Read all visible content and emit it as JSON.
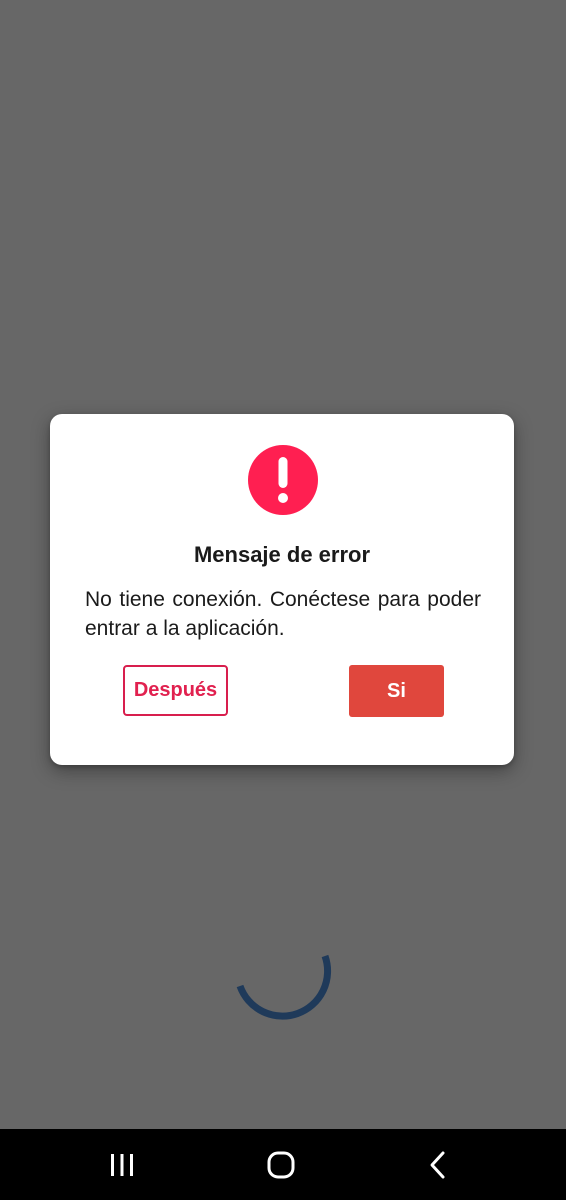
{
  "dialog": {
    "icon": "alert-circle-icon",
    "title": "Mensaje de error",
    "message": "No tiene conexión. Conéctese para poder entrar a la aplicación.",
    "later_label": "Después",
    "yes_label": "Si"
  },
  "colors": {
    "background_overlay": "#676767",
    "dialog_bg": "#ffffff",
    "alert_red": "#ff1f51",
    "later_border": "#d81e4d",
    "yes_bg": "#e0473d",
    "spinner": "#1f3a5a",
    "navbar_bg": "#000000"
  },
  "loading": {
    "icon": "loading-spinner"
  },
  "navbar": {
    "recent_icon": "recent-apps-icon",
    "home_icon": "home-icon",
    "back_icon": "back-icon"
  }
}
